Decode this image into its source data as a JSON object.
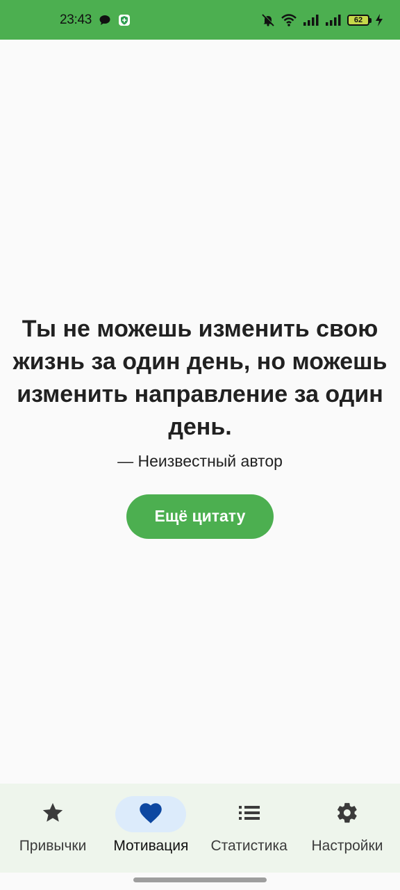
{
  "status_bar": {
    "time": "23:43",
    "battery": "62",
    "icons": [
      "chat-bubble-icon",
      "shield-icon",
      "bell-off-icon",
      "wifi-icon",
      "signal-icon",
      "signal-icon",
      "battery-icon",
      "charging-icon"
    ]
  },
  "quote": {
    "text": "Ты не можешь изменить свою жизнь за один день, но можешь изменить направление за один день.",
    "author": "— Неизвестный автор",
    "button_label": "Ещё цитату"
  },
  "bottom_nav": {
    "items": [
      {
        "label": "Привычки",
        "icon": "star-icon",
        "active": false
      },
      {
        "label": "Мотивация",
        "icon": "heart-icon",
        "active": true
      },
      {
        "label": "Статистика",
        "icon": "list-icon",
        "active": false
      },
      {
        "label": "Настройки",
        "icon": "gear-icon",
        "active": false
      }
    ]
  },
  "colors": {
    "accent": "#4caf50",
    "active_icon": "#0d47a1",
    "active_pill": "#dcebfb",
    "nav_background": "#eef5ec",
    "background": "#fafafa"
  }
}
